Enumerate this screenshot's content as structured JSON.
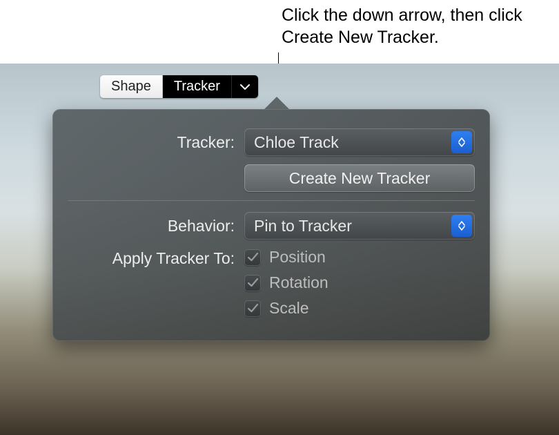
{
  "callout": "Click the down arrow, then click Create New Tracker.",
  "segmented": {
    "shape": "Shape",
    "tracker": "Tracker"
  },
  "panel": {
    "tracker_label": "Tracker:",
    "tracker_value": "Chloe Track",
    "create_button": "Create New Tracker",
    "behavior_label": "Behavior:",
    "behavior_value": "Pin to Tracker",
    "apply_label": "Apply Tracker To:",
    "checks": [
      {
        "label": "Position",
        "checked": true
      },
      {
        "label": "Rotation",
        "checked": true
      },
      {
        "label": "Scale",
        "checked": true
      }
    ]
  }
}
